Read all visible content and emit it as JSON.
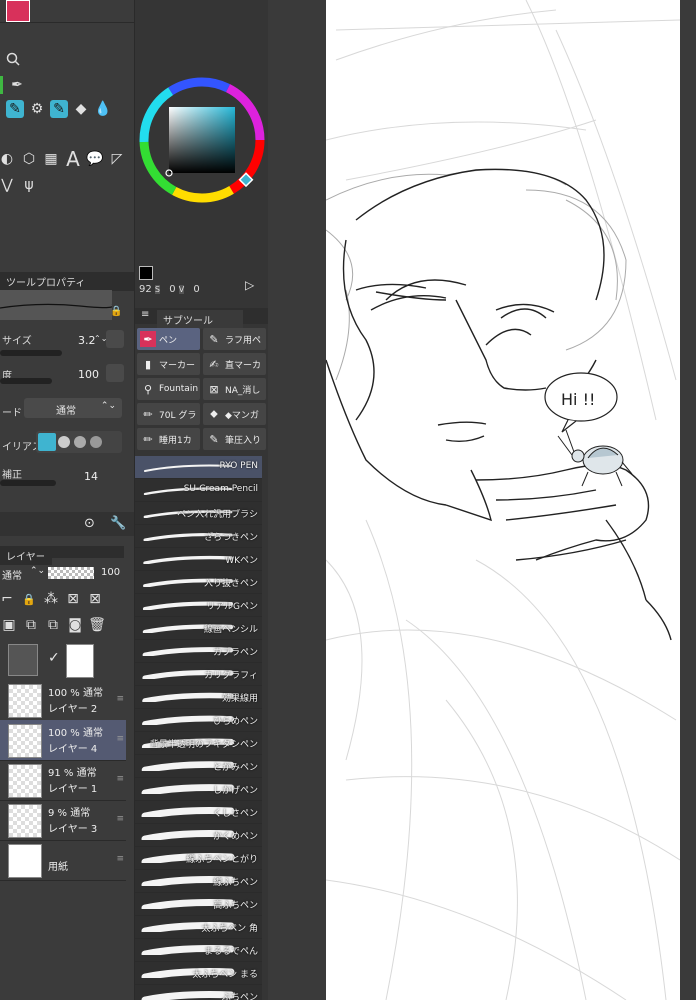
{
  "tool_property": {
    "tab_label": "ツールプロパティ",
    "size_label": "サイズ",
    "size_value": "3.2",
    "opacity_label": "度",
    "opacity_value": "100",
    "blend_label": "ード",
    "blend_value": "通常",
    "aa_label": "イリアス",
    "stabilize_label": "補正",
    "stabilize_value": "14"
  },
  "color": {
    "values_text": "92",
    "v1": "0",
    "v2": "0",
    "accent": "#3fb4d0"
  },
  "subtool": {
    "tab_label": "サブツール",
    "tools": [
      {
        "label": "ペン",
        "selected": true
      },
      {
        "label": "ラフ用ペ",
        "selected": false
      },
      {
        "label": "マーカー",
        "selected": false
      },
      {
        "label": "直マーカ",
        "selected": false
      },
      {
        "label": "Fountain",
        "selected": false
      },
      {
        "label": "NA_消し",
        "selected": false
      },
      {
        "label": "70L グラ",
        "selected": false
      },
      {
        "label": "◆マンガ",
        "selected": false
      },
      {
        "label": "睡用1カ",
        "selected": false
      },
      {
        "label": "筆圧入り",
        "selected": false
      }
    ],
    "brushes": [
      "RYO PEN",
      "SU-Cream Pencil",
      "ペン入れ汎用ブラシ",
      "ざらつきペン",
      "WKペン",
      "入り抜きペン",
      "リアルGペン",
      "線画ペンシル",
      "カブラペン",
      "カリグラフィ",
      "効果線用",
      "ひらめペン",
      "背景半透明のフキダシペン",
      "とがみペン",
      "しかげペン",
      "くしさペン",
      "かくめペン",
      "線ふちペンとがり",
      "線ふちペン",
      "高ふちペン",
      "太ふちペン 角",
      "まるるでペん",
      "太ふちペン まる",
      "ぶちペン"
    ]
  },
  "layers": {
    "tab_label": "レイヤー",
    "blend_value": "通常",
    "opacity_value": "100",
    "items": [
      {
        "pct": "100 % 通常",
        "name": "レイヤー 2",
        "selected": false
      },
      {
        "pct": "100 % 通常",
        "name": "レイヤー 4",
        "selected": true
      },
      {
        "pct": "91 % 通常",
        "name": "レイヤー 1",
        "selected": false
      },
      {
        "pct": "9 % 通常",
        "name": "レイヤー 3",
        "selected": false
      },
      {
        "pct": "",
        "name": "用紙",
        "selected": false
      }
    ]
  },
  "canvas": {
    "speech_text": "Hi !!"
  },
  "icons": [
    "search-icon",
    "brush-icon",
    "gear-icon",
    "eraser-icon",
    "drop-icon",
    "lock-icon",
    "trash-icon",
    "text-icon",
    "speech-bubble-icon",
    "wrench-icon"
  ]
}
